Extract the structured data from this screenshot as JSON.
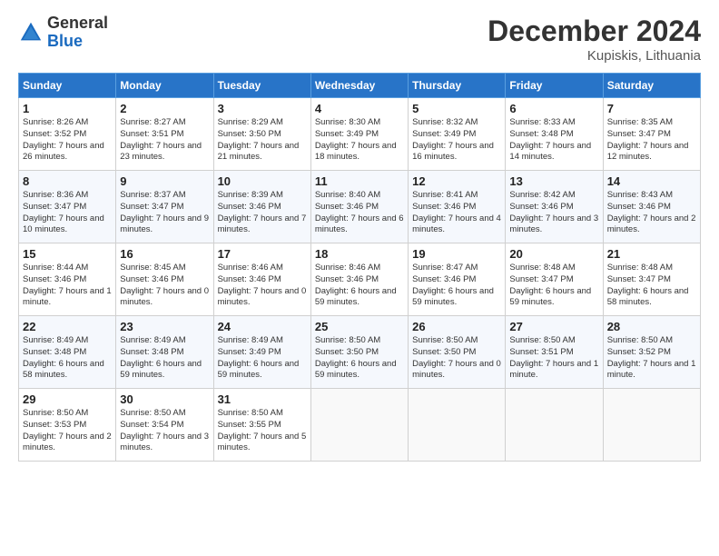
{
  "logo": {
    "general": "General",
    "blue": "Blue"
  },
  "header": {
    "month": "December 2024",
    "location": "Kupiskis, Lithuania"
  },
  "weekdays": [
    "Sunday",
    "Monday",
    "Tuesday",
    "Wednesday",
    "Thursday",
    "Friday",
    "Saturday"
  ],
  "weeks": [
    [
      {
        "day": "1",
        "sunrise": "Sunrise: 8:26 AM",
        "sunset": "Sunset: 3:52 PM",
        "daylight": "Daylight: 7 hours and 26 minutes."
      },
      {
        "day": "2",
        "sunrise": "Sunrise: 8:27 AM",
        "sunset": "Sunset: 3:51 PM",
        "daylight": "Daylight: 7 hours and 23 minutes."
      },
      {
        "day": "3",
        "sunrise": "Sunrise: 8:29 AM",
        "sunset": "Sunset: 3:50 PM",
        "daylight": "Daylight: 7 hours and 21 minutes."
      },
      {
        "day": "4",
        "sunrise": "Sunrise: 8:30 AM",
        "sunset": "Sunset: 3:49 PM",
        "daylight": "Daylight: 7 hours and 18 minutes."
      },
      {
        "day": "5",
        "sunrise": "Sunrise: 8:32 AM",
        "sunset": "Sunset: 3:49 PM",
        "daylight": "Daylight: 7 hours and 16 minutes."
      },
      {
        "day": "6",
        "sunrise": "Sunrise: 8:33 AM",
        "sunset": "Sunset: 3:48 PM",
        "daylight": "Daylight: 7 hours and 14 minutes."
      },
      {
        "day": "7",
        "sunrise": "Sunrise: 8:35 AM",
        "sunset": "Sunset: 3:47 PM",
        "daylight": "Daylight: 7 hours and 12 minutes."
      }
    ],
    [
      {
        "day": "8",
        "sunrise": "Sunrise: 8:36 AM",
        "sunset": "Sunset: 3:47 PM",
        "daylight": "Daylight: 7 hours and 10 minutes."
      },
      {
        "day": "9",
        "sunrise": "Sunrise: 8:37 AM",
        "sunset": "Sunset: 3:47 PM",
        "daylight": "Daylight: 7 hours and 9 minutes."
      },
      {
        "day": "10",
        "sunrise": "Sunrise: 8:39 AM",
        "sunset": "Sunset: 3:46 PM",
        "daylight": "Daylight: 7 hours and 7 minutes."
      },
      {
        "day": "11",
        "sunrise": "Sunrise: 8:40 AM",
        "sunset": "Sunset: 3:46 PM",
        "daylight": "Daylight: 7 hours and 6 minutes."
      },
      {
        "day": "12",
        "sunrise": "Sunrise: 8:41 AM",
        "sunset": "Sunset: 3:46 PM",
        "daylight": "Daylight: 7 hours and 4 minutes."
      },
      {
        "day": "13",
        "sunrise": "Sunrise: 8:42 AM",
        "sunset": "Sunset: 3:46 PM",
        "daylight": "Daylight: 7 hours and 3 minutes."
      },
      {
        "day": "14",
        "sunrise": "Sunrise: 8:43 AM",
        "sunset": "Sunset: 3:46 PM",
        "daylight": "Daylight: 7 hours and 2 minutes."
      }
    ],
    [
      {
        "day": "15",
        "sunrise": "Sunrise: 8:44 AM",
        "sunset": "Sunset: 3:46 PM",
        "daylight": "Daylight: 7 hours and 1 minute."
      },
      {
        "day": "16",
        "sunrise": "Sunrise: 8:45 AM",
        "sunset": "Sunset: 3:46 PM",
        "daylight": "Daylight: 7 hours and 0 minutes."
      },
      {
        "day": "17",
        "sunrise": "Sunrise: 8:46 AM",
        "sunset": "Sunset: 3:46 PM",
        "daylight": "Daylight: 7 hours and 0 minutes."
      },
      {
        "day": "18",
        "sunrise": "Sunrise: 8:46 AM",
        "sunset": "Sunset: 3:46 PM",
        "daylight": "Daylight: 6 hours and 59 minutes."
      },
      {
        "day": "19",
        "sunrise": "Sunrise: 8:47 AM",
        "sunset": "Sunset: 3:46 PM",
        "daylight": "Daylight: 6 hours and 59 minutes."
      },
      {
        "day": "20",
        "sunrise": "Sunrise: 8:48 AM",
        "sunset": "Sunset: 3:47 PM",
        "daylight": "Daylight: 6 hours and 59 minutes."
      },
      {
        "day": "21",
        "sunrise": "Sunrise: 8:48 AM",
        "sunset": "Sunset: 3:47 PM",
        "daylight": "Daylight: 6 hours and 58 minutes."
      }
    ],
    [
      {
        "day": "22",
        "sunrise": "Sunrise: 8:49 AM",
        "sunset": "Sunset: 3:48 PM",
        "daylight": "Daylight: 6 hours and 58 minutes."
      },
      {
        "day": "23",
        "sunrise": "Sunrise: 8:49 AM",
        "sunset": "Sunset: 3:48 PM",
        "daylight": "Daylight: 6 hours and 59 minutes."
      },
      {
        "day": "24",
        "sunrise": "Sunrise: 8:49 AM",
        "sunset": "Sunset: 3:49 PM",
        "daylight": "Daylight: 6 hours and 59 minutes."
      },
      {
        "day": "25",
        "sunrise": "Sunrise: 8:50 AM",
        "sunset": "Sunset: 3:50 PM",
        "daylight": "Daylight: 6 hours and 59 minutes."
      },
      {
        "day": "26",
        "sunrise": "Sunrise: 8:50 AM",
        "sunset": "Sunset: 3:50 PM",
        "daylight": "Daylight: 7 hours and 0 minutes."
      },
      {
        "day": "27",
        "sunrise": "Sunrise: 8:50 AM",
        "sunset": "Sunset: 3:51 PM",
        "daylight": "Daylight: 7 hours and 1 minute."
      },
      {
        "day": "28",
        "sunrise": "Sunrise: 8:50 AM",
        "sunset": "Sunset: 3:52 PM",
        "daylight": "Daylight: 7 hours and 1 minute."
      }
    ],
    [
      {
        "day": "29",
        "sunrise": "Sunrise: 8:50 AM",
        "sunset": "Sunset: 3:53 PM",
        "daylight": "Daylight: 7 hours and 2 minutes."
      },
      {
        "day": "30",
        "sunrise": "Sunrise: 8:50 AM",
        "sunset": "Sunset: 3:54 PM",
        "daylight": "Daylight: 7 hours and 3 minutes."
      },
      {
        "day": "31",
        "sunrise": "Sunrise: 8:50 AM",
        "sunset": "Sunset: 3:55 PM",
        "daylight": "Daylight: 7 hours and 5 minutes."
      },
      null,
      null,
      null,
      null
    ]
  ]
}
